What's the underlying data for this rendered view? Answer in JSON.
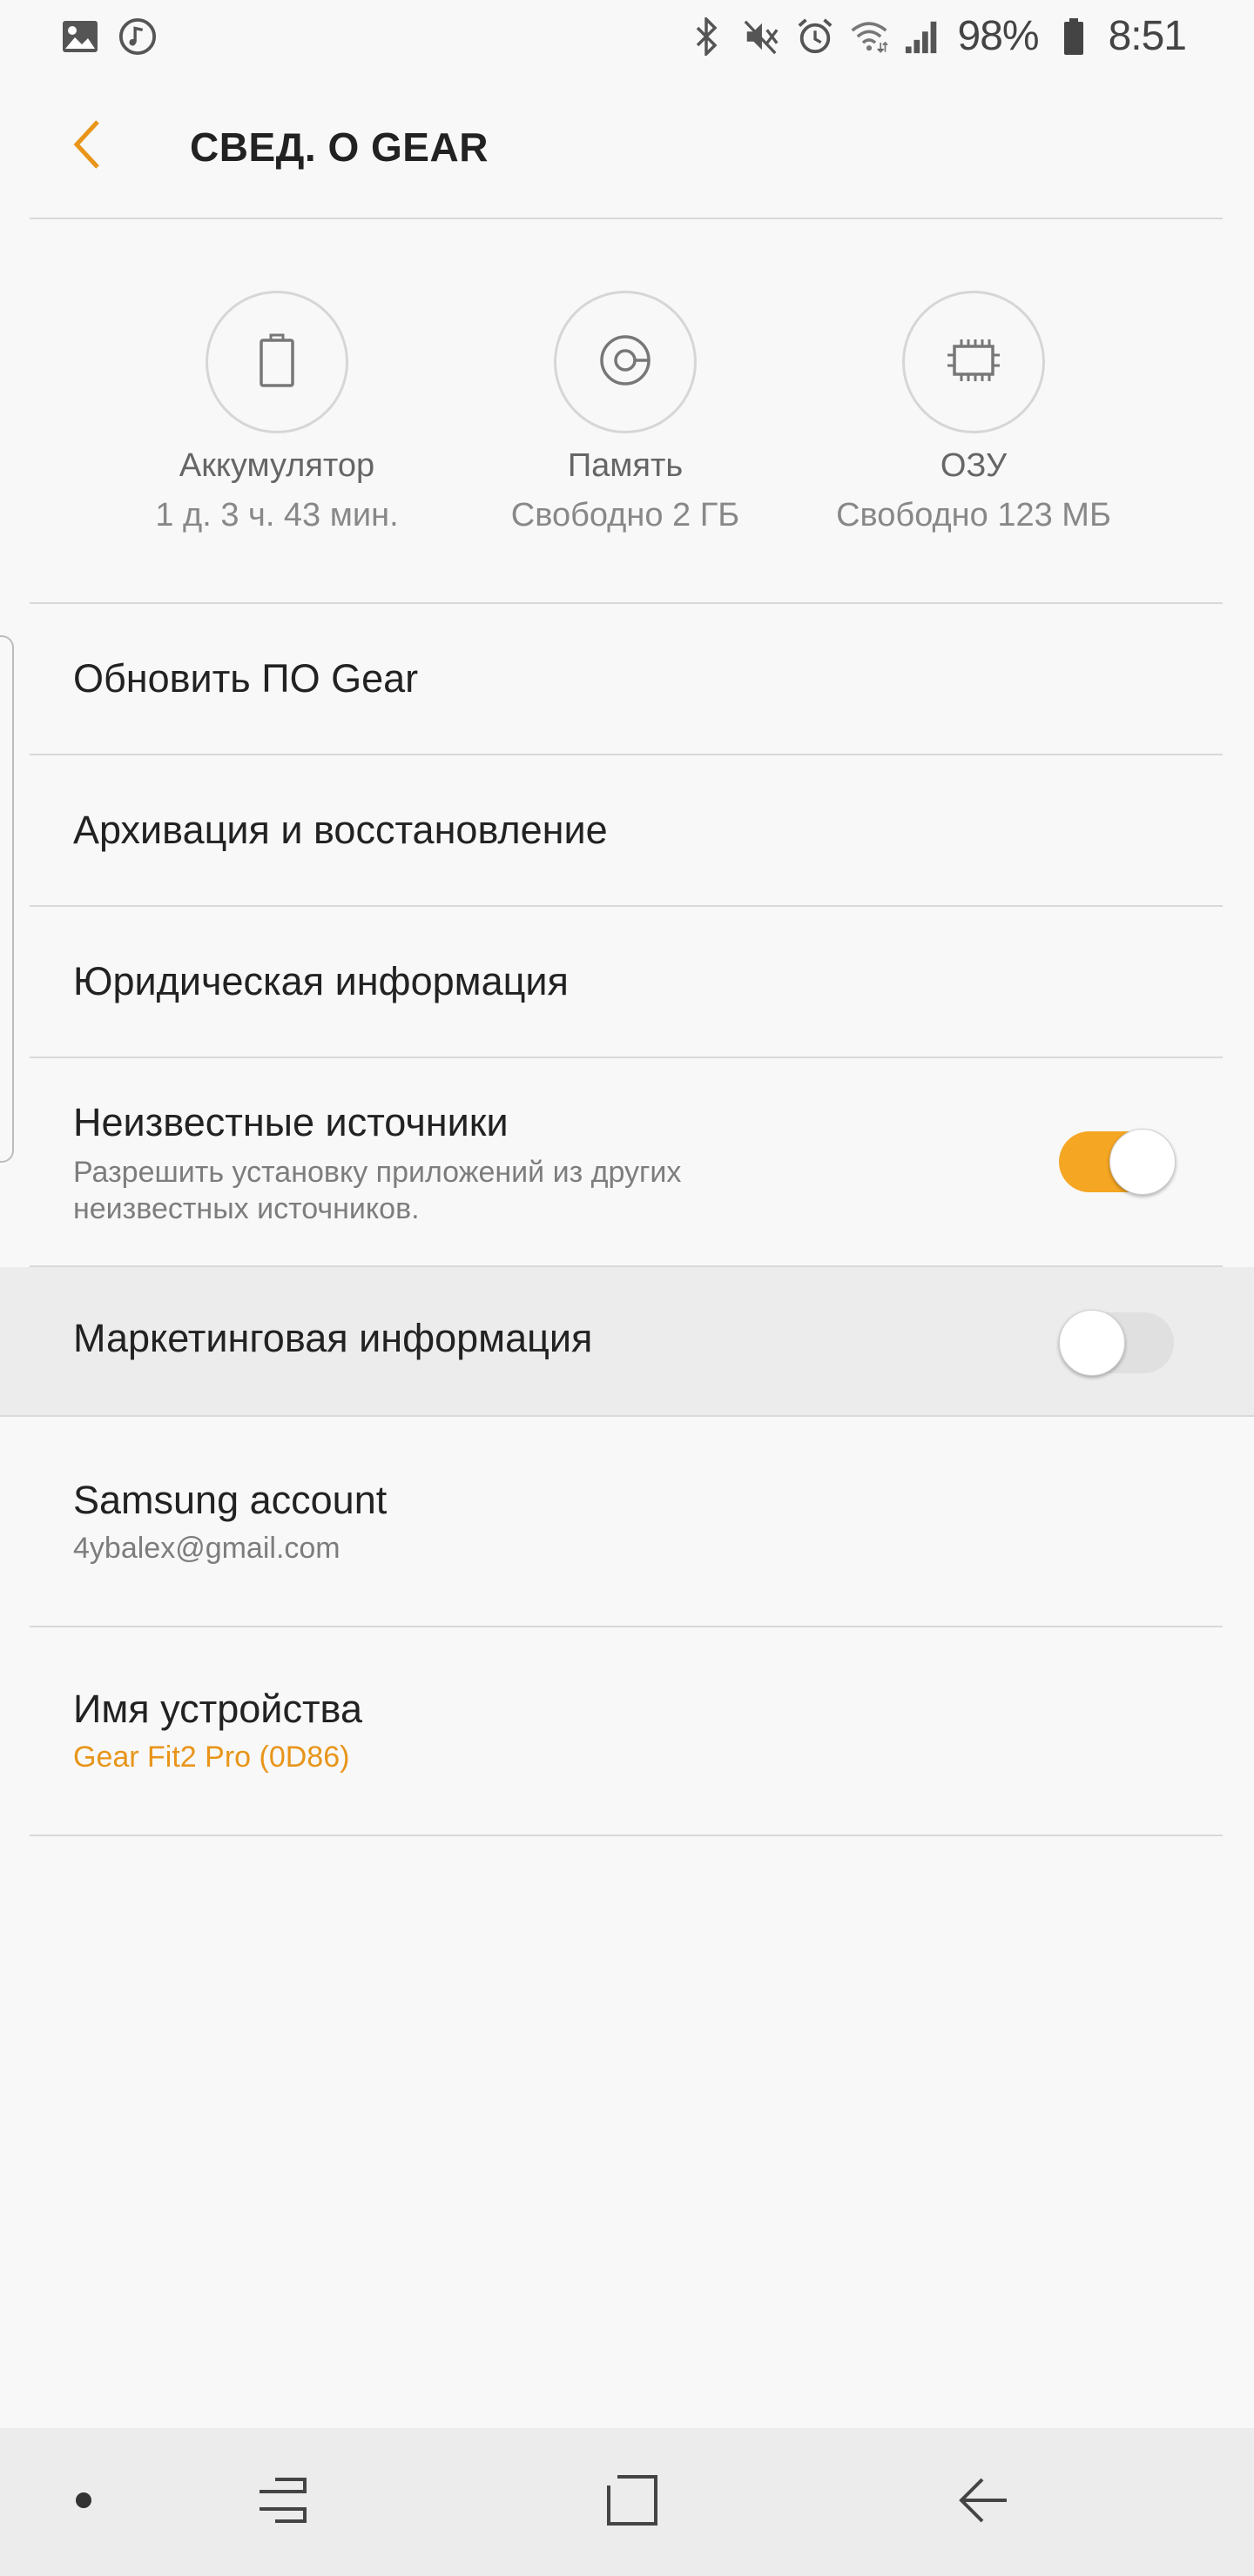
{
  "status_bar": {
    "battery_percent": "98%",
    "time": "8:51",
    "left_icons": [
      "gallery-icon",
      "music-icon"
    ],
    "right_icons": [
      "bluetooth-icon",
      "mute-icon",
      "alarm-icon",
      "wifi-icon",
      "signal-icon",
      "battery-icon"
    ]
  },
  "header": {
    "title": "СВЕД. О GEAR",
    "accent_color": "#e8951a"
  },
  "stats": [
    {
      "label": "Аккумулятор",
      "value": "1 д. 3 ч. 43 мин.",
      "icon": "battery-icon"
    },
    {
      "label": "Память",
      "value": "Свободно 2 ГБ",
      "icon": "storage-icon"
    },
    {
      "label": "ОЗУ",
      "value": "Свободно 123 МБ",
      "icon": "ram-chip-icon"
    }
  ],
  "menu": {
    "update": "Обновить ПО Gear",
    "backup": "Архивация и восстановление",
    "legal": "Юридическая информация",
    "unknown_sources": {
      "title": "Неизвестные источники",
      "subtitle_line1": "Разрешить установку приложений из других",
      "subtitle_line2": "неизвестных источников.",
      "enabled": true
    },
    "marketing": {
      "title": "Маркетинговая информация",
      "enabled": false
    },
    "samsung_account": {
      "title": "Samsung account",
      "email": "4ybalex@gmail.com"
    },
    "device_name": {
      "title": "Имя устройства",
      "value": "Gear Fit2 Pro (0D86)"
    }
  },
  "nav_bar": {
    "icons": [
      "dot-icon",
      "recent-apps-icon",
      "home-icon",
      "back-nav-icon"
    ]
  }
}
